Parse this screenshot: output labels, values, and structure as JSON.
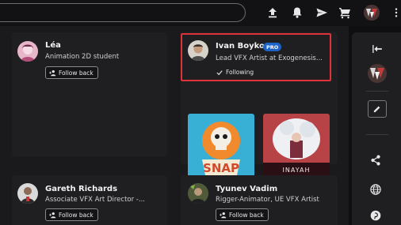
{
  "topbar": {
    "icons": [
      "upload-icon",
      "bell-icon",
      "send-icon",
      "cart-icon",
      "more-icon"
    ]
  },
  "cards": [
    {
      "name": "Léa",
      "subtitle": "Animation 2D student",
      "button": "Follow back"
    },
    {
      "name": "Ivan Boyko",
      "badge": "PRO",
      "subtitle": "Lead VFX Artist at Exogenesis...",
      "status": "Following"
    },
    {
      "name": "Gareth Richards",
      "subtitle": "Associate VFX Art Director -...",
      "button": "Follow back"
    },
    {
      "name": "Tyunev Vadim",
      "subtitle": "Rigger-Animator, UE VFX Artist",
      "button": "Follow back"
    }
  ],
  "thumbnails": [
    {
      "text": "SNAP"
    },
    {
      "text": "INAYAH"
    }
  ],
  "sidebar": {
    "icons": [
      "collapse-icon",
      "edit-icon",
      "share-icon",
      "globe-icon",
      "pinterest-icon"
    ]
  },
  "colors": {
    "accent": "#1d63c7",
    "highlight": "#e0323a",
    "background": "#1a1a1c",
    "card": "#1f1f21"
  }
}
